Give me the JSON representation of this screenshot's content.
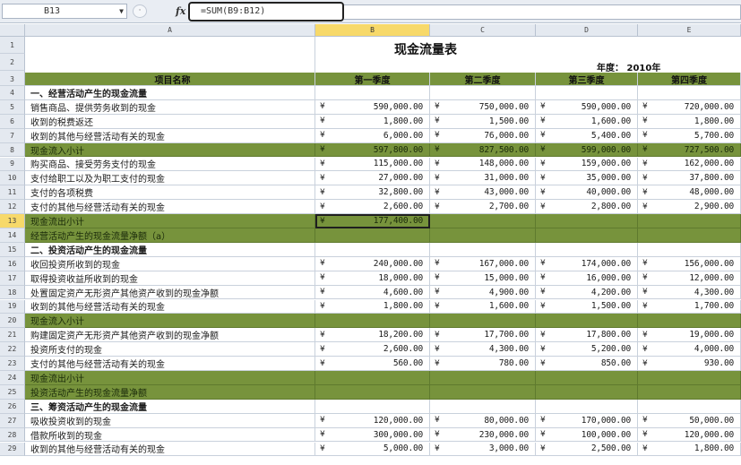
{
  "formula_bar": {
    "name_box": "B13",
    "formula": "=SUM(B9:B12)"
  },
  "columns": [
    "A",
    "B",
    "C",
    "D",
    "E"
  ],
  "selected_column": "B",
  "selected_row": "13",
  "sheet": {
    "title": "现金流量表",
    "year_label": "年度：",
    "year_value": "2010年",
    "header": [
      "项目名称",
      "第一季度",
      "第二季度",
      "第三季度",
      "第四季度"
    ],
    "currency_symbol": "¥",
    "rows": [
      {
        "num": "4",
        "label": "一、经营活动产生的现金流量",
        "style": "section",
        "values": []
      },
      {
        "num": "5",
        "label": "销售商品、提供劳务收到的现金",
        "style": "normal",
        "values": [
          "590,000.00",
          "750,000.00",
          "590,000.00",
          "720,000.00"
        ]
      },
      {
        "num": "6",
        "label": "收到的税费返还",
        "style": "normal",
        "values": [
          "1,800.00",
          "1,500.00",
          "1,600.00",
          "1,800.00"
        ]
      },
      {
        "num": "7",
        "label": "收到的其他与经营活动有关的现金",
        "style": "normal",
        "values": [
          "6,000.00",
          "76,000.00",
          "5,400.00",
          "5,700.00"
        ]
      },
      {
        "num": "8",
        "label": "现金流入小计",
        "style": "green",
        "values": [
          "597,800.00",
          "827,500.00",
          "599,000.00",
          "727,500.00"
        ]
      },
      {
        "num": "9",
        "label": "购买商品、接受劳务支付的现金",
        "style": "normal",
        "values": [
          "115,000.00",
          "148,000.00",
          "159,000.00",
          "162,000.00"
        ]
      },
      {
        "num": "10",
        "label": "支付给职工以及为职工支付的现金",
        "style": "normal",
        "values": [
          "27,000.00",
          "31,000.00",
          "35,000.00",
          "37,800.00"
        ]
      },
      {
        "num": "11",
        "label": "支付的各项税费",
        "style": "normal",
        "values": [
          "32,800.00",
          "43,000.00",
          "40,000.00",
          "48,000.00"
        ]
      },
      {
        "num": "12",
        "label": "支付的其他与经营活动有关的现金",
        "style": "normal",
        "values": [
          "2,600.00",
          "2,700.00",
          "2,800.00",
          "2,900.00"
        ]
      },
      {
        "num": "13",
        "label": "现金流出小计",
        "style": "green",
        "values": [
          "177,400.00",
          "",
          "",
          ""
        ]
      },
      {
        "num": "14",
        "label": "经营活动产生的现金流量净额（a）",
        "style": "green",
        "values": []
      },
      {
        "num": "15",
        "label": "二、投资活动产生的现金流量",
        "style": "section",
        "values": []
      },
      {
        "num": "16",
        "label": "收回投资所收到的现金",
        "style": "normal",
        "values": [
          "240,000.00",
          "167,000.00",
          "174,000.00",
          "156,000.00"
        ]
      },
      {
        "num": "17",
        "label": "取得投资收益所收到的现金",
        "style": "normal",
        "values": [
          "18,000.00",
          "15,000.00",
          "16,000.00",
          "12,000.00"
        ]
      },
      {
        "num": "18",
        "label": "处置固定资产无形资产其他资产收到的现金净额",
        "style": "normal",
        "values": [
          "4,600.00",
          "4,900.00",
          "4,200.00",
          "4,300.00"
        ]
      },
      {
        "num": "19",
        "label": "收到的其他与经营活动有关的现金",
        "style": "normal",
        "values": [
          "1,800.00",
          "1,600.00",
          "1,500.00",
          "1,700.00"
        ]
      },
      {
        "num": "20",
        "label": "现金流入小计",
        "style": "green",
        "values": []
      },
      {
        "num": "21",
        "label": "购建固定资产无形资产其他资产收到的现金净额",
        "style": "normal",
        "values": [
          "18,200.00",
          "17,700.00",
          "17,800.00",
          "19,000.00"
        ]
      },
      {
        "num": "22",
        "label": "投资所支付的现金",
        "style": "normal",
        "values": [
          "2,600.00",
          "4,300.00",
          "5,200.00",
          "4,000.00"
        ]
      },
      {
        "num": "23",
        "label": "支付的其他与经营活动有关的现金",
        "style": "normal",
        "values": [
          "560.00",
          "780.00",
          "850.00",
          "930.00"
        ]
      },
      {
        "num": "24",
        "label": "现金流出小计",
        "style": "green",
        "values": []
      },
      {
        "num": "25",
        "label": "投资活动产生的现金流量净额",
        "style": "green",
        "values": []
      },
      {
        "num": "26",
        "label": "三、筹资活动产生的现金流量",
        "style": "section",
        "values": []
      },
      {
        "num": "27",
        "label": "吸收投资收到的现金",
        "style": "normal",
        "values": [
          "120,000.00",
          "80,000.00",
          "170,000.00",
          "50,000.00"
        ]
      },
      {
        "num": "28",
        "label": "借款所收到的现金",
        "style": "normal",
        "values": [
          "300,000.00",
          "230,000.00",
          "100,000.00",
          "120,000.00"
        ]
      },
      {
        "num": "29",
        "label": "收到的其他与经营活动有关的现金",
        "style": "normal",
        "values": [
          "5,000.00",
          "3,000.00",
          "2,500.00",
          "1,800.00"
        ]
      }
    ]
  }
}
